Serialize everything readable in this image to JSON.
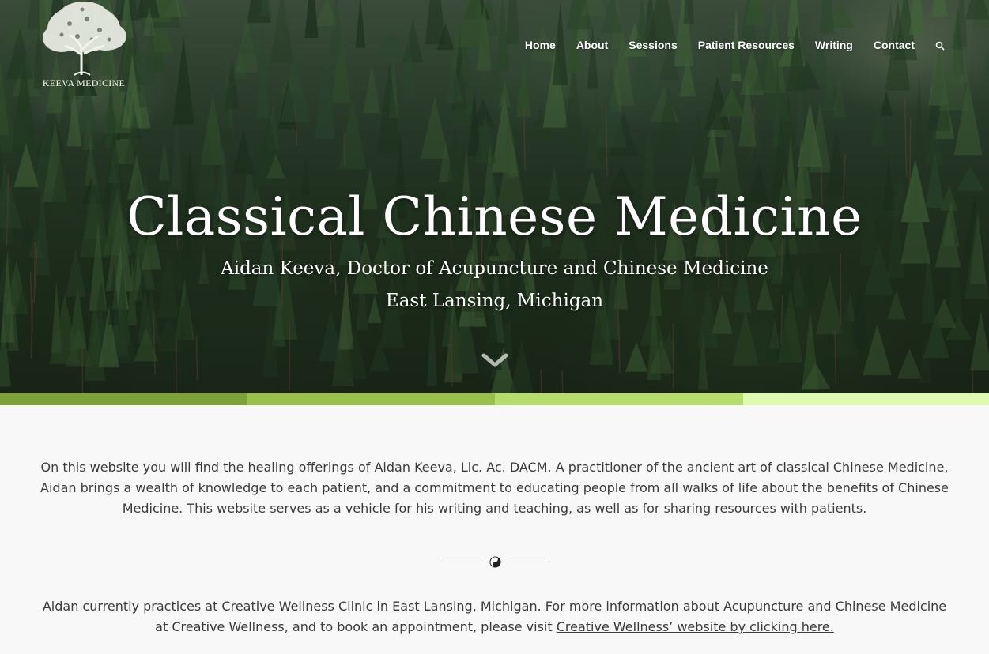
{
  "logo": {
    "text": "KEEVA MEDICINE",
    "icon": "tree-icon"
  },
  "nav": {
    "items": [
      {
        "label": "Home"
      },
      {
        "label": "About"
      },
      {
        "label": "Sessions"
      },
      {
        "label": "Patient Resources"
      },
      {
        "label": "Writing"
      },
      {
        "label": "Contact"
      }
    ],
    "search_icon": "search-icon"
  },
  "hero": {
    "title": "Classical Chinese Medicine",
    "subtitle": "Aidan Keeva, Doctor of Acupuncture and Chinese Medicine",
    "location": "East Lansing, Michigan",
    "scroll_icon": "chevron-down-icon"
  },
  "colors": {
    "stripe": [
      "#7ea23a",
      "#98c04b",
      "#b6dc6c",
      "#e0f9b0"
    ]
  },
  "content": {
    "intro": "On this website you will find the healing offerings of Aidan Keeva, Lic. Ac. DACM. A practitioner of the ancient art of classical Chinese Medicine, Aidan brings a wealth of knowledge to each patient, and a commitment to educating people from all walks of life about the benefits of Chinese Medicine. This website serves as a vehicle for his writing and teaching, as well as for sharing resources with patients.",
    "divider_icon": "yin-yang-icon",
    "practice_text": "Aidan currently practices at Creative Wellness Clinic in East Lansing, Michigan. For more information about Acupuncture and Chinese Medicine at Creative Wellness, and to book an appointment, please visit ",
    "practice_link": "Creative Wellness’ website by clicking here."
  }
}
